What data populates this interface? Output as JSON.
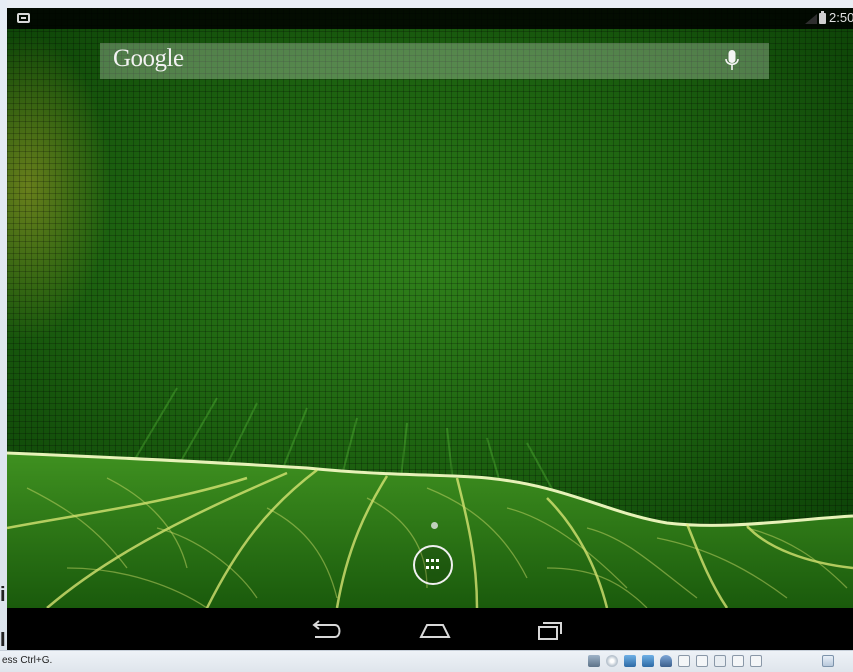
{
  "status_bar": {
    "time": "2:50",
    "icons": [
      "screen-icon",
      "signal-icon",
      "battery-icon"
    ]
  },
  "search": {
    "logo_text": "Google",
    "voice_icon": "mic-icon"
  },
  "home": {
    "page_indicator_count": 1,
    "app_drawer_icon": "all-apps-icon"
  },
  "nav_bar": {
    "buttons": [
      "back-icon",
      "home-icon",
      "recents-icon"
    ]
  },
  "host": {
    "status_text": "ess Ctrl+G.",
    "tray_icons": [
      "hard-disk-icon",
      "optical-drive-icon",
      "network-icon",
      "network-icon",
      "usb-icon",
      "shared-folder-icon",
      "shared-folder-icon",
      "display-icon",
      "video-capture-icon",
      "video-capture-icon",
      "host-key-icon"
    ]
  },
  "colors": {
    "wallpaper_primary": "#1d6210",
    "nav_bar": "#000000",
    "search_bar_bg": "rgba(255,255,255,0.26)"
  }
}
